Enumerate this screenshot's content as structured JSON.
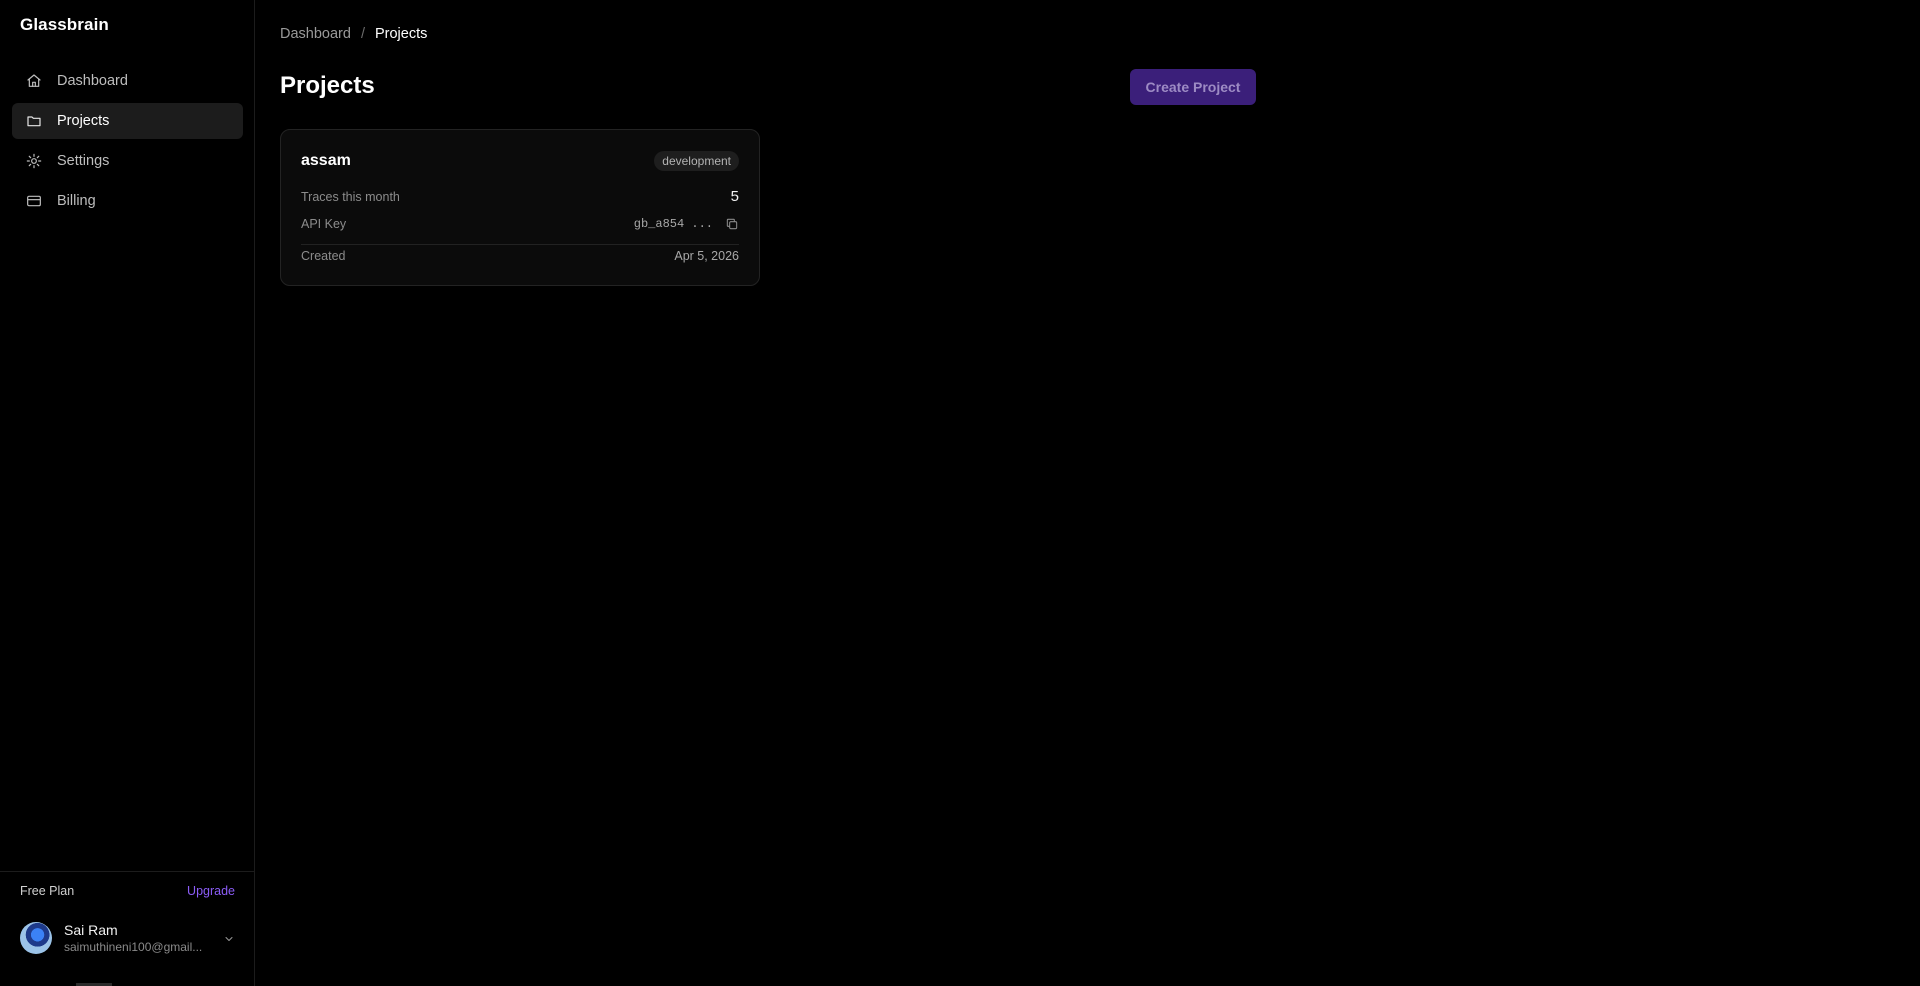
{
  "app": {
    "brand": "Glassbrain"
  },
  "sidebar": {
    "items": [
      {
        "label": "Dashboard",
        "icon": "home-icon",
        "active": false
      },
      {
        "label": "Projects",
        "icon": "folder-icon",
        "active": true
      },
      {
        "label": "Settings",
        "icon": "gear-icon",
        "active": false
      },
      {
        "label": "Billing",
        "icon": "credit-card-icon",
        "active": false
      }
    ],
    "plan_label": "Free Plan",
    "upgrade_label": "Upgrade",
    "user": {
      "name": "Sai Ram",
      "email": "saimuthineni100@gmail..."
    }
  },
  "breadcrumb": {
    "parent": "Dashboard",
    "separator": "/",
    "current": "Projects"
  },
  "page": {
    "title": "Projects",
    "create_label": "Create Project"
  },
  "projects": [
    {
      "name": "assam",
      "environment": "development",
      "traces_label": "Traces this month",
      "traces_value": "5",
      "api_key_label": "API Key",
      "api_key_value": "gb_a854 ...",
      "created_label": "Created",
      "created_value": "Apr 5, 2026"
    }
  ],
  "colors": {
    "background": "#000000",
    "accent": "#8b5cf6",
    "button": "#3b1f7a",
    "card": "#0b0b0b"
  }
}
